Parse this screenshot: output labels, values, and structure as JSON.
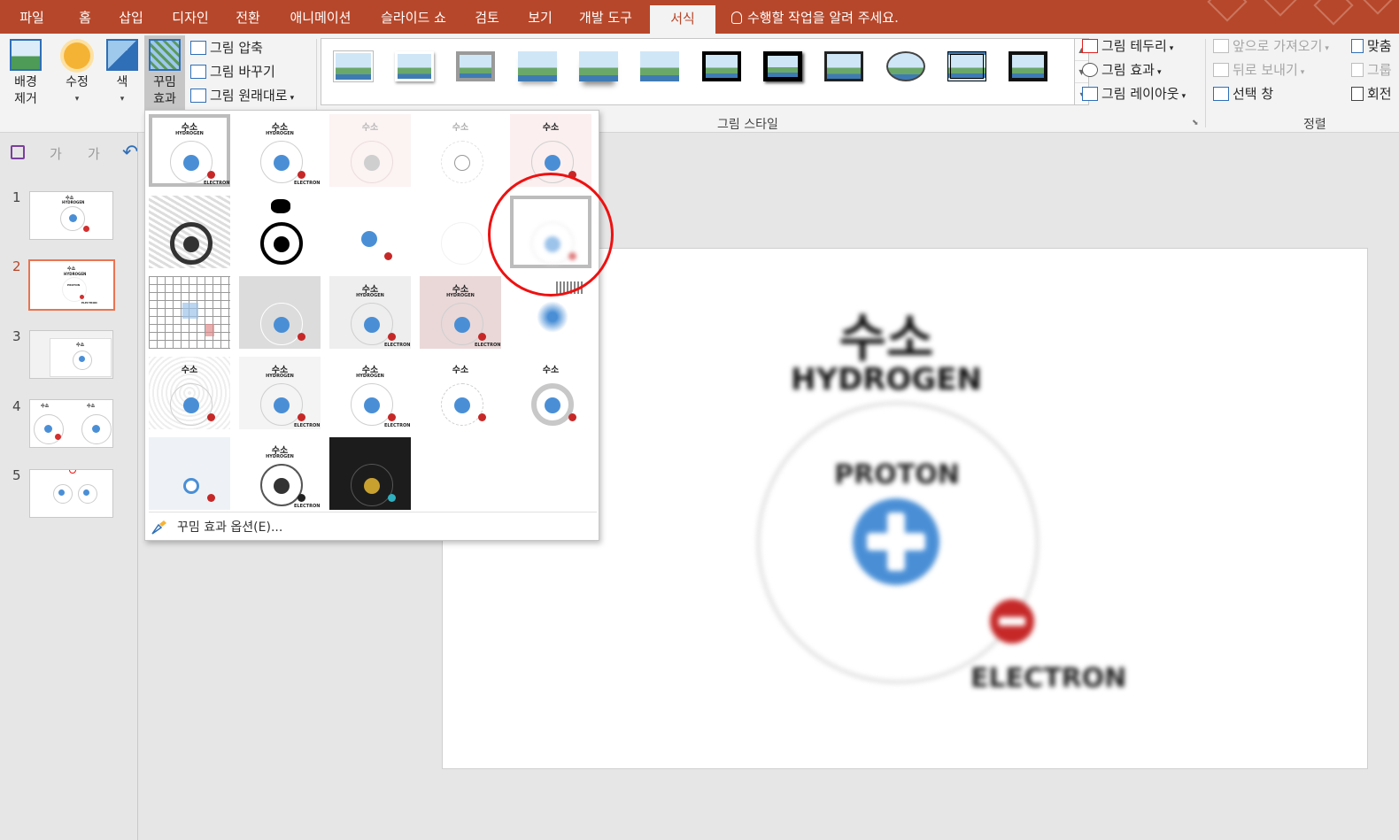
{
  "tabs": [
    {
      "label": "파일"
    },
    {
      "label": "홈"
    },
    {
      "label": "삽입"
    },
    {
      "label": "디자인"
    },
    {
      "label": "전환"
    },
    {
      "label": "애니메이션"
    },
    {
      "label": "슬라이드 쇼"
    },
    {
      "label": "검토"
    },
    {
      "label": "보기"
    },
    {
      "label": "개발 도구"
    },
    {
      "label": "서식"
    }
  ],
  "tell_me": "수행할 작업을 알려 주세요.",
  "ribbon": {
    "remove_background": "배경\n제거",
    "corrections": "수정",
    "color": "색",
    "artistic_effects": "꾸밈\n효과",
    "compress": "그림 압축",
    "change_picture": "그림 바꾸기",
    "reset_picture": "그림 원래대로",
    "picture_styles_label": "그림 스타일",
    "picture_border": "그림 테두리",
    "picture_effects": "그림 효과",
    "picture_layout": "그림 레이아웃",
    "bring_forward": "앞으로 가져오기",
    "send_backward": "뒤로 보내기",
    "selection_pane": "선택 창",
    "arrange_label": "정렬",
    "align": "맞춤",
    "group": "그룹",
    "rotate": "회전"
  },
  "qat": {
    "font_increase": "가",
    "font_decrease": "가"
  },
  "slides": [
    {
      "number": "1"
    },
    {
      "number": "2"
    },
    {
      "number": "3"
    },
    {
      "number": "4"
    },
    {
      "number": "5"
    }
  ],
  "slide": {
    "title": "수소",
    "subtitle": "HYDROGEN",
    "proton": "PROTON",
    "electron": "ELECTRON"
  },
  "thumb_text": {
    "title": "수소",
    "subtitle": "HYDROGEN",
    "proton": "PROTON",
    "electron": "ELECTRON"
  },
  "artistic_effects_menu": {
    "options_label": "꾸밈 효과 옵션(E)...",
    "effect_count": 23,
    "selected_index": 0,
    "highlighted_index": 9
  },
  "colors": {
    "accent": "#b7472a",
    "ribbon": "#f3f3f3",
    "proton_blue": "#4a8fd6",
    "electron_red": "#c62828",
    "annotation_ring": "#ee1111"
  }
}
